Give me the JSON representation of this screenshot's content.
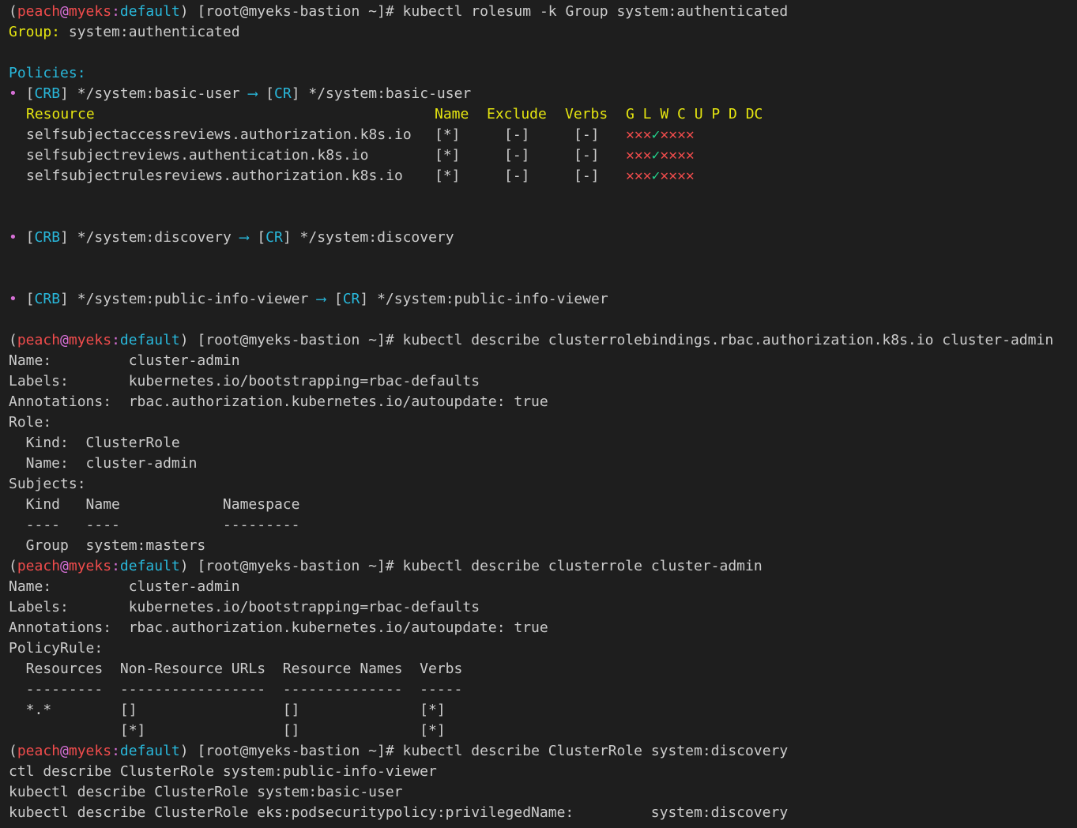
{
  "prompt": {
    "open": "(",
    "user": "peach",
    "at": "@",
    "cluster": "myeks",
    "colon": ":",
    "ns": "default",
    "close": ")",
    "rest": " [root@myeks-bastion ~]# "
  },
  "cmds": {
    "c1": "kubectl rolesum -k Group system:authenticated",
    "c2": "kubectl describe clusterrolebindings.rbac.authorization.k8s.io cluster-admin",
    "c3": "kubectl describe clusterrole cluster-admin",
    "c4": "kubectl describe ClusterRole system:discovery"
  },
  "rolesum": {
    "group_label": "Group:",
    "group_value": " system:authenticated",
    "policies_label": "Policies:",
    "bullet": "•",
    "bindings": [
      {
        "crb": "CRB",
        "crb_name": " */system:basic-user ",
        "arrow": "⟶",
        "cr": "CR",
        "cr_name": " */system:basic-user"
      },
      {
        "crb": "CRB",
        "crb_name": " */system:discovery ",
        "arrow": "⟶",
        "cr": "CR",
        "cr_name": " */system:discovery"
      },
      {
        "crb": "CRB",
        "crb_name": " */system:public-info-viewer ",
        "arrow": "⟶",
        "cr": "CR",
        "cr_name": " */system:public-info-viewer"
      }
    ],
    "headers": {
      "resource": "Resource",
      "name": "Name",
      "exclude": "Exclude",
      "verbs": "Verbs",
      "flags": "G L W C U P D DC"
    },
    "rows": [
      {
        "resource": "selfsubjectaccessreviews.authorization.k8s.io",
        "name": "[*]",
        "exclude": "[-]",
        "verbs": "[-]",
        "perms": [
          "✕",
          "✕",
          "✕",
          "✓",
          "✕",
          "✕",
          "✕",
          "✕"
        ]
      },
      {
        "resource": "selfsubjectreviews.authentication.k8s.io",
        "name": "[*]",
        "exclude": "[-]",
        "verbs": "[-]",
        "perms": [
          "✕",
          "✕",
          "✕",
          "✓",
          "✕",
          "✕",
          "✕",
          "✕"
        ]
      },
      {
        "resource": "selfsubjectrulesreviews.authorization.k8s.io",
        "name": "[*]",
        "exclude": "[-]",
        "verbs": "[-]",
        "perms": [
          "✕",
          "✕",
          "✕",
          "✓",
          "✕",
          "✕",
          "✕",
          "✕"
        ]
      }
    ]
  },
  "crb": {
    "name": "Name:         cluster-admin",
    "labels": "Labels:       kubernetes.io/bootstrapping=rbac-defaults",
    "annotations": "Annotations:  rbac.authorization.kubernetes.io/autoupdate: true",
    "role": "Role:",
    "kind": "  Kind:  ClusterRole",
    "rname": "  Name:  cluster-admin",
    "subjects": "Subjects:",
    "sub_header": "  Kind   Name            Namespace",
    "sub_sep": "  ----   ----            ---------",
    "sub_row": "  Group  system:masters"
  },
  "cr": {
    "name": "Name:         cluster-admin",
    "labels": "Labels:       kubernetes.io/bootstrapping=rbac-defaults",
    "annotations": "Annotations:  rbac.authorization.kubernetes.io/autoupdate: true",
    "policy": "PolicyRule:",
    "header": "  Resources  Non-Resource URLs  Resource Names  Verbs",
    "sep": "  ---------  -----------------  --------------  -----",
    "row1": "  *.*        []                 []              [*]",
    "row2": "             [*]                []              [*]"
  },
  "tail": {
    "l1": "ctl describe ClusterRole system:public-info-viewer",
    "l2": "kubectl describe ClusterRole system:basic-user",
    "l3": "kubectl describe ClusterRole eks:podsecuritypolicy:privilegedName:         system:discovery"
  }
}
